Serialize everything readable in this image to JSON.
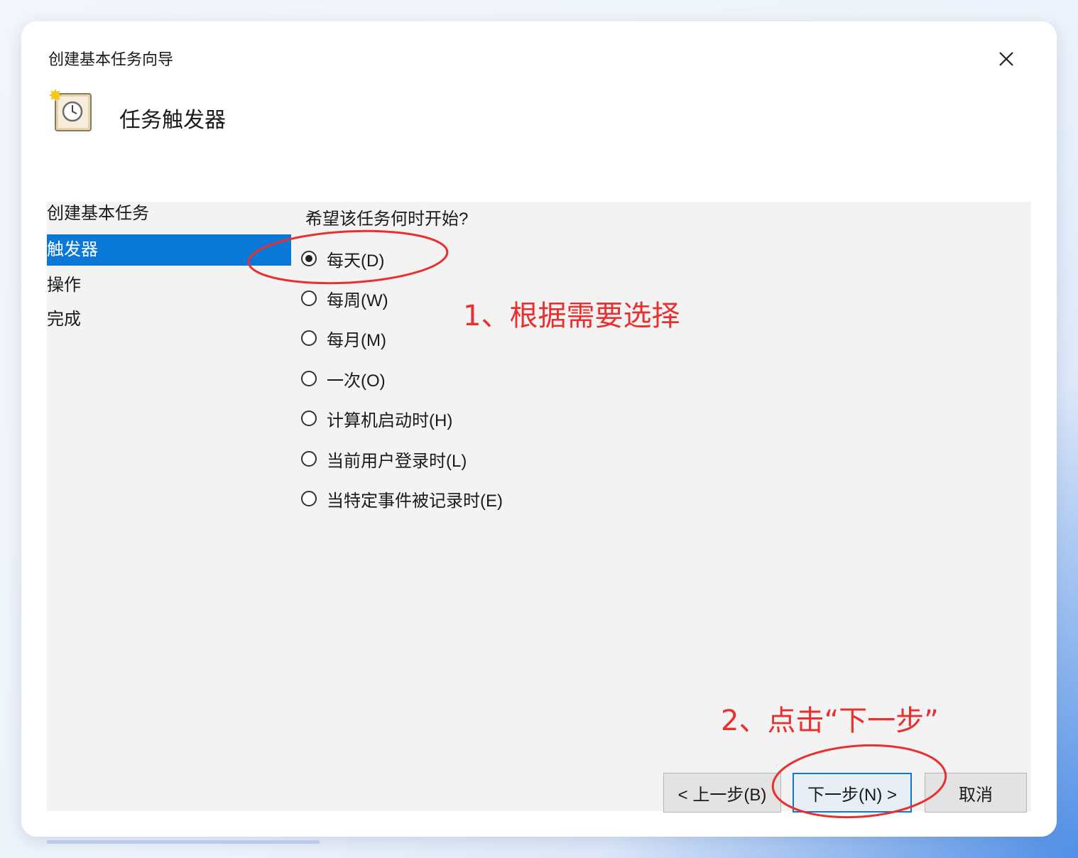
{
  "window": {
    "title": "创建基本任务向导",
    "header_title": "任务触发器",
    "close_icon": "close-icon",
    "wizard_icon": "task-clock-icon"
  },
  "steps": [
    {
      "label": "创建基本任务",
      "active": false
    },
    {
      "label": "触发器",
      "active": true
    },
    {
      "label": "操作",
      "active": false
    },
    {
      "label": "完成",
      "active": false
    }
  ],
  "main": {
    "question": "希望该任务何时开始?",
    "options": [
      {
        "label": "每天(D)",
        "selected": true
      },
      {
        "label": "每周(W)",
        "selected": false
      },
      {
        "label": "每月(M)",
        "selected": false
      },
      {
        "label": "一次(O)",
        "selected": false
      },
      {
        "label": "计算机启动时(H)",
        "selected": false
      },
      {
        "label": "当前用户登录时(L)",
        "selected": false
      },
      {
        "label": "当特定事件被记录时(E)",
        "selected": false
      }
    ]
  },
  "buttons": {
    "back": "< 上一步(B)",
    "next": "下一步(N) >",
    "cancel": "取消"
  },
  "annotations": {
    "step1": "1、根据需要选择",
    "step2": "2、点击“下一步”",
    "highlight_color": "#ea2f2f"
  },
  "colors": {
    "accent": "#0a78d7",
    "panel": "#f3f3f3"
  }
}
